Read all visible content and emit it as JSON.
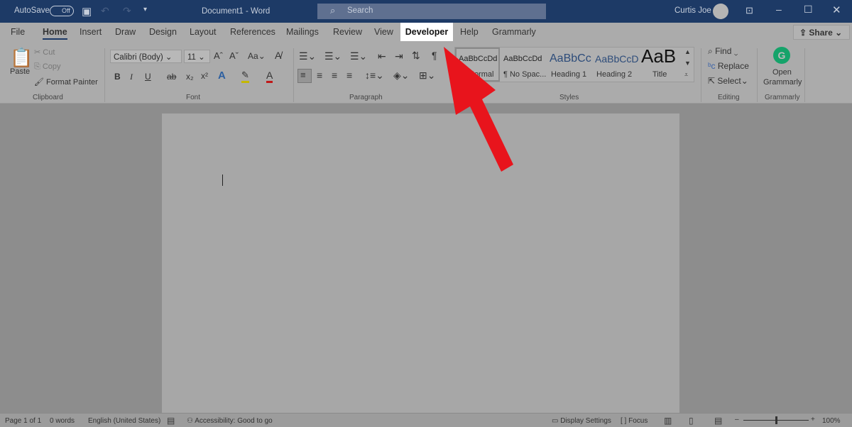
{
  "titlebar": {
    "autosave_label": "AutoSave",
    "autosave_state": "Off",
    "title": "Document1  -  Word",
    "search_placeholder": "Search",
    "user_name": "Curtis Joe"
  },
  "tabs": [
    "File",
    "Home",
    "Insert",
    "Draw",
    "Design",
    "Layout",
    "References",
    "Mailings",
    "Review",
    "View",
    "Developer",
    "Help",
    "Grammarly"
  ],
  "share_label": "Share",
  "clipboard": {
    "paste": "Paste",
    "cut": "Cut",
    "copy": "Copy",
    "format_painter": "Format Painter",
    "group": "Clipboard"
  },
  "font": {
    "name": "Calibri (Body)",
    "size": "11",
    "bold": "B",
    "italic": "I",
    "underline": "U",
    "strike": "ab",
    "sub": "x₂",
    "sup": "x²",
    "change_case": "Aa",
    "group": "Font"
  },
  "paragraph": {
    "pilcrow": "¶",
    "group": "Paragraph"
  },
  "styles": {
    "items": [
      {
        "preview": "AaBbCcDd",
        "label": "Normal"
      },
      {
        "preview": "AaBbCcDd",
        "label": "¶ No Spac..."
      },
      {
        "preview": "AaBbCc",
        "label": "Heading 1"
      },
      {
        "preview": "AaBbCcD",
        "label": "Heading 2"
      },
      {
        "preview": "AaB",
        "label": "Title"
      }
    ],
    "group": "Styles"
  },
  "editing": {
    "find": "Find",
    "replace": "Replace",
    "select": "Select",
    "group": "Editing"
  },
  "grammarly": {
    "open": "Open",
    "open2": "Grammarly",
    "group": "Grammarly"
  },
  "status": {
    "page": "Page 1 of 1",
    "words": "0 words",
    "language": "English (United States)",
    "accessibility": "Accessibility: Good to go",
    "display_settings": "Display Settings",
    "focus": "Focus",
    "zoom": "100%",
    "zoom_level_percent": 100
  },
  "colors": {
    "titlebar": "#1d3a66",
    "highlight_tab": "#ffffff",
    "arrow": "#e8141c",
    "grammarly": "#15a36a"
  }
}
